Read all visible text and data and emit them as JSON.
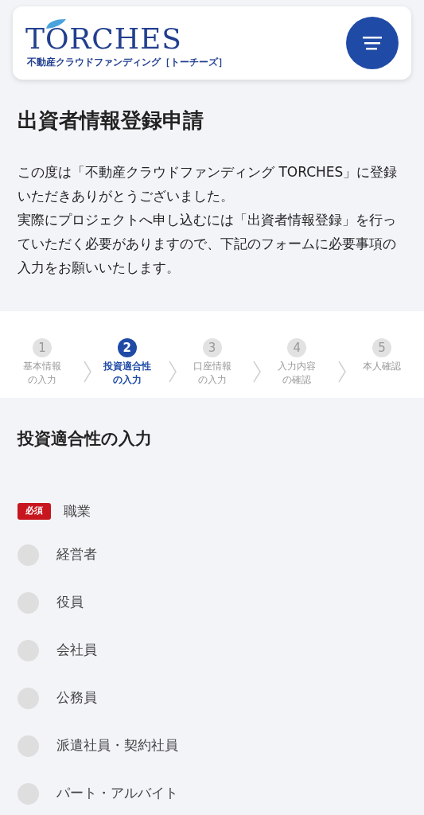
{
  "header": {
    "logo": "TORCHES",
    "tagline": "不動産クラウドファンディング［トーチーズ］"
  },
  "intro": {
    "title": "出資者情報登録申請",
    "paragraphs": [
      "この度は「不動産クラウドファンディング TORCHES」に登録いただきありがとうございました。",
      "実際にプロジェクトへ申し込むには「出資者情報登録」を行っていただく必要がありますので、下記のフォームに必要事項の入力をお願いいたします。"
    ]
  },
  "steps": [
    {
      "number": "1",
      "label_lines": [
        "基本情報",
        "の入力"
      ],
      "selected": false
    },
    {
      "number": "2",
      "label_lines": [
        "投資適合性",
        "の入力"
      ],
      "selected": true
    },
    {
      "number": "3",
      "label_lines": [
        "口座情報",
        "の入力"
      ],
      "selected": false
    },
    {
      "number": "4",
      "label_lines": [
        "入力内容",
        "の確認"
      ],
      "selected": false
    },
    {
      "number": "5",
      "label_lines": [
        "本人確認"
      ],
      "selected": false
    }
  ],
  "form": {
    "title": "投資適合性の入力",
    "field": {
      "required_badge": "必須",
      "label": "職業"
    },
    "options": [
      {
        "label": "経営者",
        "selected": false
      },
      {
        "label": "役員",
        "selected": false
      },
      {
        "label": "会社員",
        "selected": false
      },
      {
        "label": "公務員",
        "selected": false
      },
      {
        "label": "派遣社員・契約社員",
        "selected": false
      },
      {
        "label": "パート・アルバイト",
        "selected": false
      }
    ]
  }
}
